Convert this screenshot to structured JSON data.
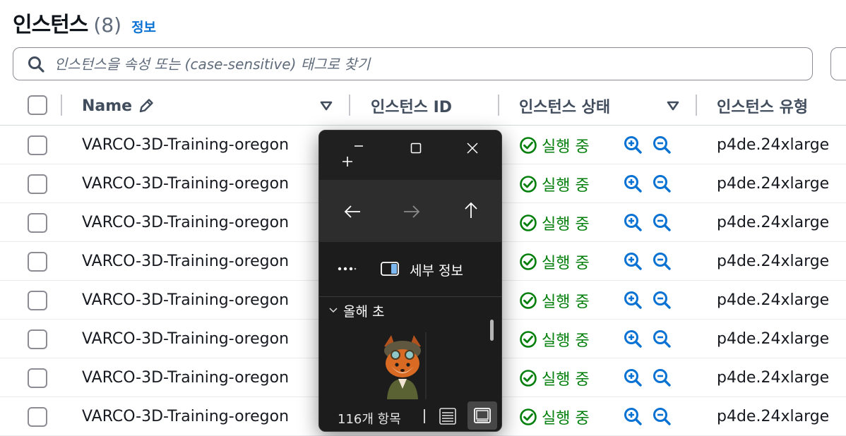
{
  "header": {
    "title": "인스턴스",
    "count": "(8)",
    "info_link": "정보"
  },
  "search": {
    "placeholder": "인스턴스을 속성 또는 (case-sensitive) 태그로 찾기"
  },
  "table": {
    "columns": [
      "Name",
      "인스턴스 ID",
      "인스턴스 상태",
      "인스턴스 유형"
    ],
    "rows": [
      {
        "name": "VARCO-3D-Training-oregon",
        "status": "실행 중",
        "type": "p4de.24xlarge"
      },
      {
        "name": "VARCO-3D-Training-oregon",
        "status": "실행 중",
        "type": "p4de.24xlarge"
      },
      {
        "name": "VARCO-3D-Training-oregon",
        "status": "실행 중",
        "type": "p4de.24xlarge"
      },
      {
        "name": "VARCO-3D-Training-oregon",
        "status": "실행 중",
        "type": "p4de.24xlarge"
      },
      {
        "name": "VARCO-3D-Training-oregon",
        "status": "실행 중",
        "type": "p4de.24xlarge"
      },
      {
        "name": "VARCO-3D-Training-oregon",
        "status": "실행 중",
        "type": "p4de.24xlarge"
      },
      {
        "name": "VARCO-3D-Training-oregon",
        "status": "실행 중",
        "type": "p4de.24xlarge"
      },
      {
        "name": "VARCO-3D-Training-oregon",
        "status": "실행 중",
        "type": "p4de.24xlarge"
      }
    ]
  },
  "explorer": {
    "details_label": "세부 정보",
    "group_label": "올해 초",
    "item_count": "116개 항목"
  },
  "colors": {
    "link": "#0972d3",
    "running": "#037f0c",
    "panel_bg": "#1f1f1f"
  },
  "icons": [
    "search-icon",
    "edit-icon",
    "sort-down-icon",
    "status-success-icon",
    "zoom-in-icon",
    "zoom-out-icon",
    "minimize-icon",
    "maximize-icon",
    "close-icon",
    "new-tab-icon",
    "back-arrow-icon",
    "forward-arrow-icon",
    "up-arrow-icon",
    "more-icon",
    "details-pane-icon",
    "chevron-down-icon",
    "details-view-icon",
    "preview-view-icon"
  ]
}
